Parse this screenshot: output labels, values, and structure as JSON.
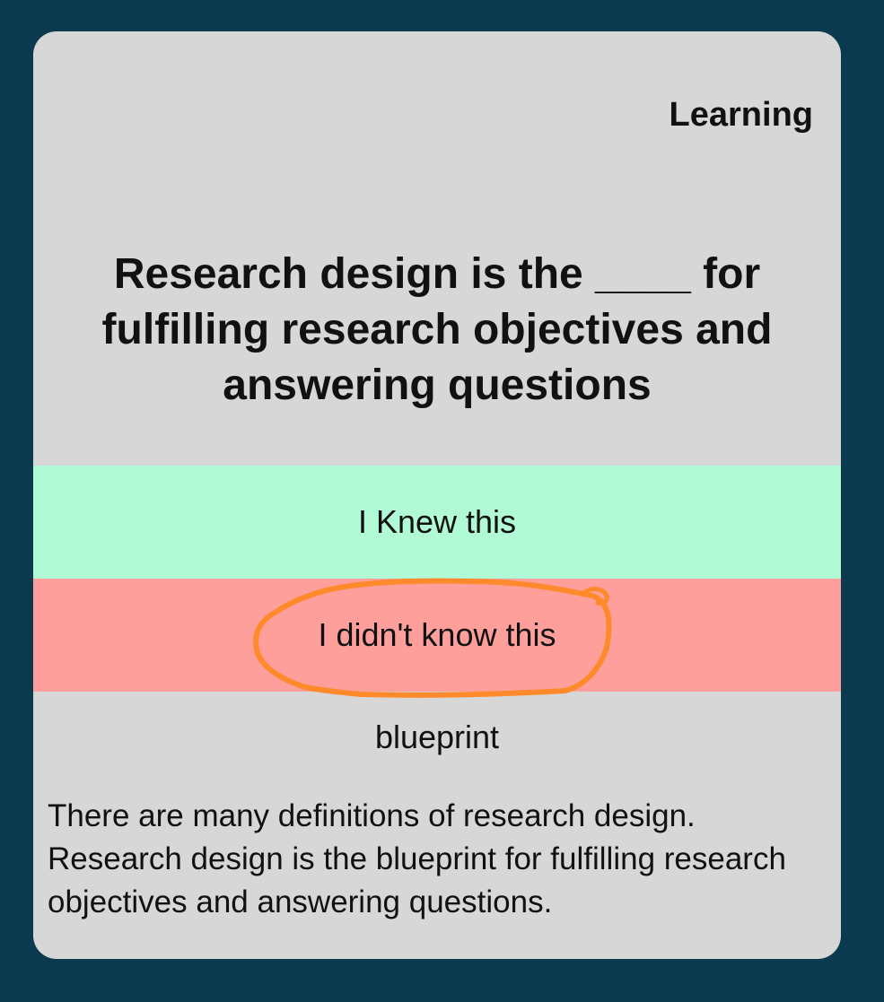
{
  "card": {
    "mode_label": "Learning",
    "question": "Research design is the ____ for fulfilling research objectives and answering questions",
    "buttons": {
      "knew": "I Knew this",
      "didnt_know": "I didn't know this"
    },
    "answer": "blueprint",
    "explanation": "There are many definitions of research design. Research design is the blueprint for fulfilling research objectives and answering questions."
  },
  "colors": {
    "background": "#0b3a4f",
    "card": "#d7d7d7",
    "knew_button": "#b0fbd6",
    "didnt_know_button": "#ff9f9b",
    "annotation_stroke": "#ff8a2b"
  }
}
